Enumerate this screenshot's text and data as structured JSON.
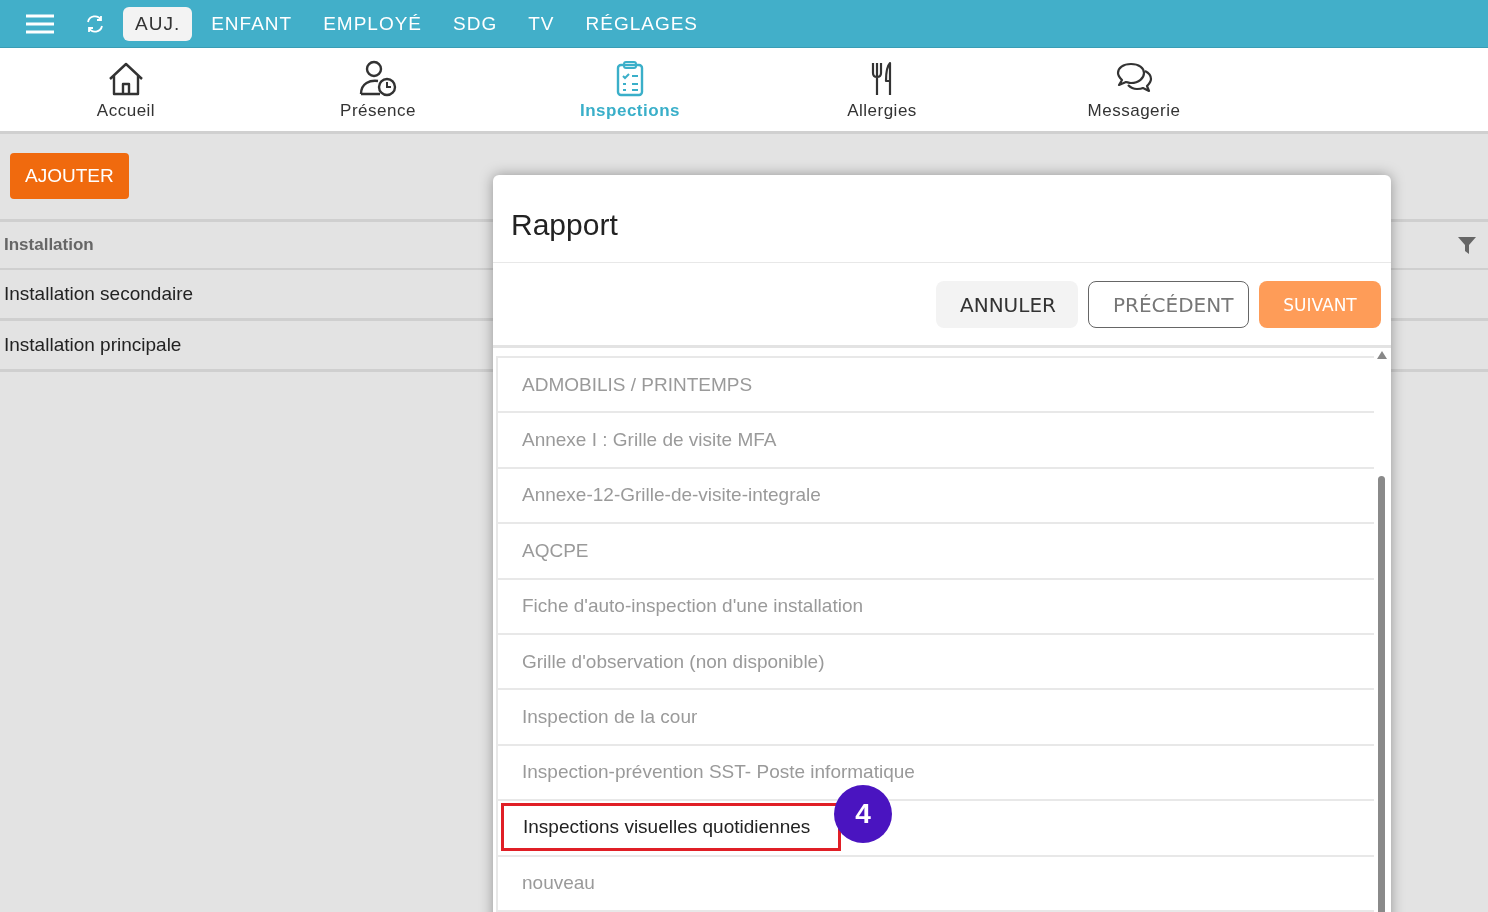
{
  "top_tabs": [
    {
      "label": "AUJ.",
      "selected": true
    },
    {
      "label": "ENFANT",
      "selected": false
    },
    {
      "label": "EMPLOYÉ",
      "selected": false
    },
    {
      "label": "SDG",
      "selected": false
    },
    {
      "label": "TV",
      "selected": false
    },
    {
      "label": "RÉGLAGES",
      "selected": false
    }
  ],
  "nav": [
    {
      "kind": "home",
      "label": "Accueil",
      "selected": false
    },
    {
      "kind": "presence",
      "label": "Présence",
      "selected": false
    },
    {
      "kind": "clipboard",
      "label": "Inspections",
      "selected": true
    },
    {
      "kind": "cutlery",
      "label": "Allergies",
      "selected": false
    },
    {
      "kind": "chat",
      "label": "Messagerie",
      "selected": false
    }
  ],
  "add_button": "AJOUTER",
  "table": {
    "column": "Installation",
    "rows": [
      "Installation secondaire",
      "Installation principale"
    ]
  },
  "dialog": {
    "title": "Rapport",
    "buttons": [
      {
        "kind": "flat",
        "label": "ANNULER"
      },
      {
        "kind": "outline",
        "label": "PRÉCÉDENT"
      },
      {
        "kind": "primary",
        "label": "SUIVANT"
      }
    ],
    "items": [
      {
        "label": "ADMOBILIS / PRINTEMPS",
        "highlighted": false
      },
      {
        "label": "Annexe I : Grille de visite MFA",
        "highlighted": false
      },
      {
        "label": "Annexe-12-Grille-de-visite-integrale",
        "highlighted": false
      },
      {
        "label": "AQCPE",
        "highlighted": false
      },
      {
        "label": "Fiche d'auto-inspection d'une installation",
        "highlighted": false
      },
      {
        "label": "Grille d'observation (non disponible)",
        "highlighted": false
      },
      {
        "label": "Inspection de la cour",
        "highlighted": false
      },
      {
        "label": "Inspection-prévention SST- Poste informatique",
        "highlighted": false
      },
      {
        "label": "Inspections visuelles quotidiennes",
        "highlighted": true,
        "callout": "4"
      },
      {
        "label": "nouveau",
        "highlighted": false
      }
    ]
  }
}
